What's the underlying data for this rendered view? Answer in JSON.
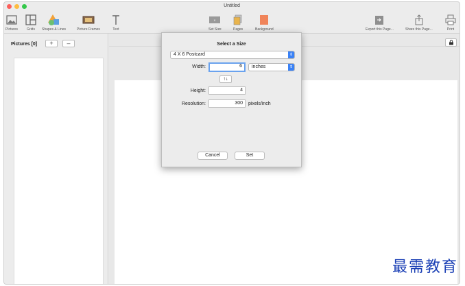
{
  "window": {
    "title": "Untitled"
  },
  "toolbar": {
    "pictures": "Pictures",
    "grids": "Grids",
    "shapes_lines": "Shapes & Lines",
    "picture_frames": "Picture Frames",
    "text": "Text",
    "set_size": "Set Size",
    "pages": "Pages",
    "background": "Background",
    "export": "Export this Page...",
    "share": "Share this Page...",
    "print": "Print"
  },
  "sidebar": {
    "title": "Pictures [0]",
    "add_label": "+",
    "remove_label": "–"
  },
  "dialog": {
    "title": "Select a Size",
    "preset": "4 X 6 Postcard",
    "width_label": "Width:",
    "width_value": "6",
    "unit": "inches",
    "swap_label": "↑↓",
    "height_label": "Height:",
    "height_value": "4",
    "resolution_label": "Resolution:",
    "resolution_value": "300",
    "resolution_unit": "pixels/inch",
    "cancel_label": "Cancel",
    "set_label": "Set"
  },
  "watermark": "最需教育",
  "colors": {
    "close": "#fc605c",
    "minimize": "#fdbc40",
    "zoom": "#34c84a",
    "background_swatch": "#f0845a",
    "accent": "#3b82f6"
  }
}
